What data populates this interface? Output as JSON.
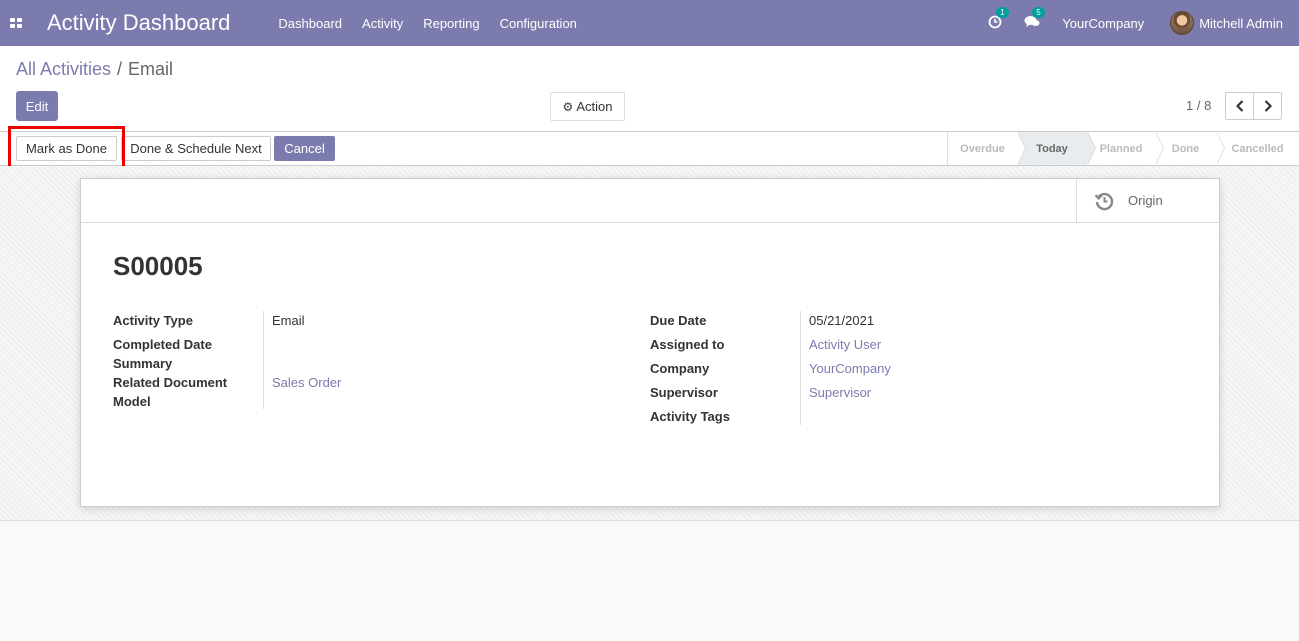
{
  "navbar": {
    "app_title": "Activity Dashboard",
    "menu": [
      "Dashboard",
      "Activity",
      "Reporting",
      "Configuration"
    ],
    "activity_count": "1",
    "message_count": "5",
    "company": "YourCompany",
    "user": "Mitchell Admin"
  },
  "breadcrumb": {
    "parent": "All Activities",
    "separator": "/",
    "current": "Email"
  },
  "toolbar": {
    "edit_label": "Edit",
    "action_label": "Action",
    "pager_value": "1 / 8"
  },
  "statusbar": {
    "mark_done_label": "Mark as Done",
    "done_next_label": "Done & Schedule Next",
    "cancel_label": "Cancel",
    "stages": [
      "Overdue",
      "Today",
      "Planned",
      "Done",
      "Cancelled"
    ],
    "active_stage": "Today"
  },
  "form": {
    "origin_label": "Origin",
    "title": "S00005",
    "left_fields": [
      {
        "label": "Activity Type",
        "value": "Email",
        "link": false
      },
      {
        "label": "Completed Date",
        "value": "",
        "link": false
      },
      {
        "label": "Summary",
        "value": "",
        "link": false
      },
      {
        "label": "Related Document Model",
        "value": "Sales Order",
        "link": true
      }
    ],
    "right_fields": [
      {
        "label": "Due Date",
        "value": "05/21/2021",
        "link": false
      },
      {
        "label": "Assigned to",
        "value": "Activity User",
        "link": true
      },
      {
        "label": "Company",
        "value": "YourCompany",
        "link": true
      },
      {
        "label": "Supervisor",
        "value": "Supervisor",
        "link": true
      },
      {
        "label": "Activity Tags",
        "value": "",
        "link": false
      }
    ]
  },
  "colors": {
    "brand": "#7c7bad",
    "badge": "#00a09d",
    "highlight": "#ee0000"
  }
}
